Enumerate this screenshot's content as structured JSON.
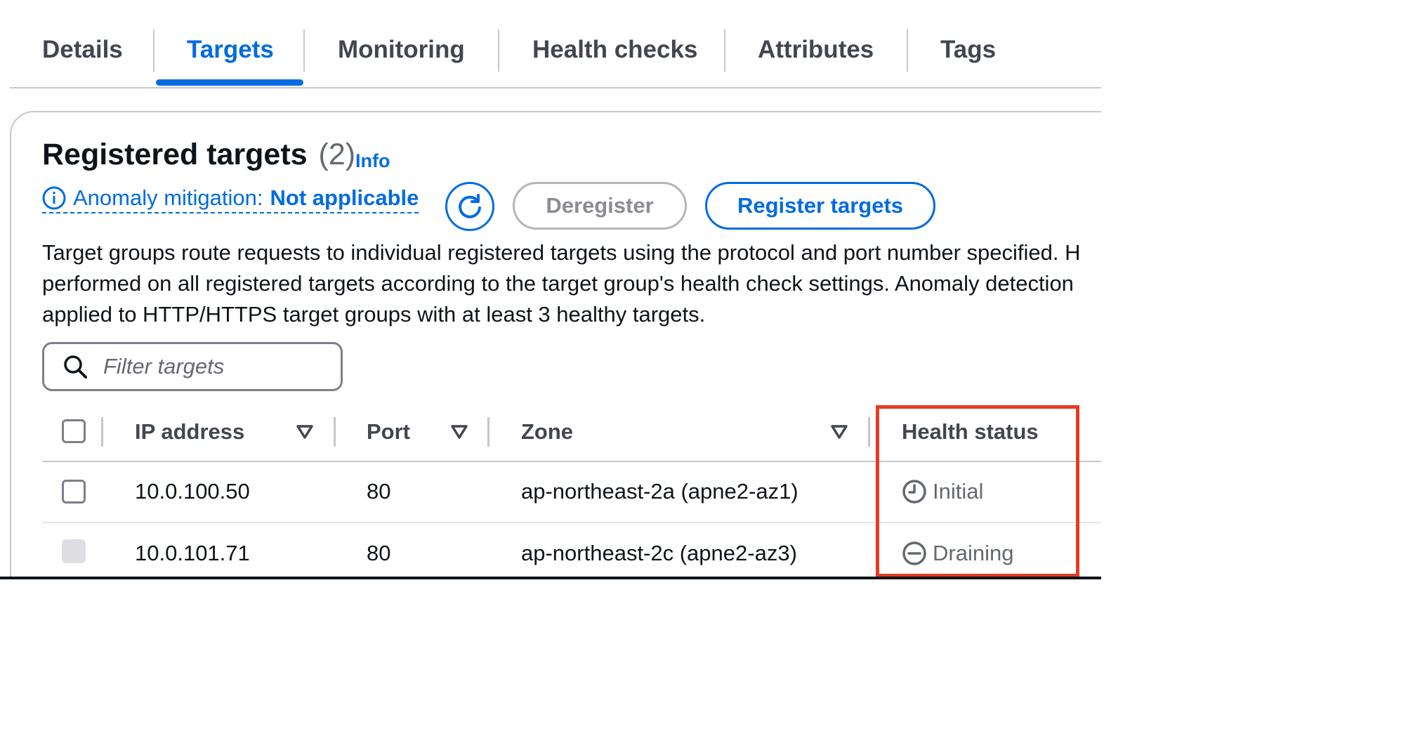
{
  "tabs": [
    {
      "label": "Details",
      "active": false
    },
    {
      "label": "Targets",
      "active": true
    },
    {
      "label": "Monitoring",
      "active": false
    },
    {
      "label": "Health checks",
      "active": false
    },
    {
      "label": "Attributes",
      "active": false
    },
    {
      "label": "Tags",
      "active": false
    }
  ],
  "panel": {
    "title": "Registered targets",
    "count": "(2)",
    "info_link": "Info",
    "anomaly_label": "Anomaly mitigation:",
    "anomaly_value": "Not applicable",
    "refresh_icon": "refresh-icon",
    "deregister_label": "Deregister",
    "register_label": "Register targets",
    "description": [
      "Target groups route requests to individual registered targets using the protocol and port number specified. H",
      "performed on all registered targets according to the target group's health check settings. Anomaly detection",
      "applied to HTTP/HTTPS target groups with at least 3 healthy targets."
    ],
    "filter_placeholder": "Filter targets"
  },
  "table": {
    "columns": [
      "IP address",
      "Port",
      "Zone",
      "Health status"
    ],
    "rows": [
      {
        "ip": "10.0.100.50",
        "port": "80",
        "zone": "ap-northeast-2a (apne2-az1)",
        "health": "Initial",
        "health_icon": "clock-icon",
        "selectable": true
      },
      {
        "ip": "10.0.101.71",
        "port": "80",
        "zone": "ap-northeast-2c (apne2-az3)",
        "health": "Draining",
        "health_icon": "minus-circle-icon",
        "selectable": false
      }
    ]
  },
  "colors": {
    "accent": "#006ce0",
    "highlight": "#e53a24",
    "muted": "#656871"
  }
}
